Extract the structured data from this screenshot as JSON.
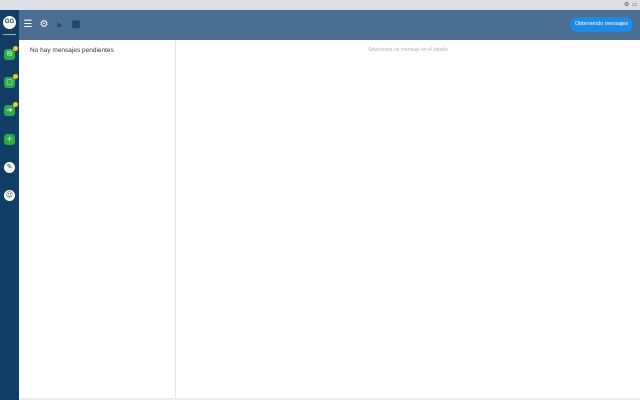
{
  "sidebar": {
    "brand": "GG",
    "items": [
      {
        "icon": "chat-icon",
        "glyph": "✉",
        "badge": true
      },
      {
        "icon": "message-icon",
        "glyph": "▢",
        "badge": true
      },
      {
        "icon": "forward-icon",
        "glyph": "➜",
        "badge": true
      },
      {
        "icon": "add-icon",
        "glyph": "+",
        "badge": false
      },
      {
        "icon": "edit-icon",
        "glyph": "✎",
        "badge": false
      },
      {
        "icon": "users-icon",
        "glyph": "☺",
        "badge": false
      }
    ]
  },
  "toolbar": {
    "action_button": "Obteniendo mensajes"
  },
  "list": {
    "empty_text": "No hay mensajes pendientes"
  },
  "detail": {
    "placeholder": "Seleccione un mensaje en el listado"
  },
  "colors": {
    "sidebar": "#123e66",
    "toolbar": "#4b6f93",
    "accent": "#1b8be8",
    "item_green": "#2ea84a",
    "badge_yellow": "#f3c623"
  }
}
